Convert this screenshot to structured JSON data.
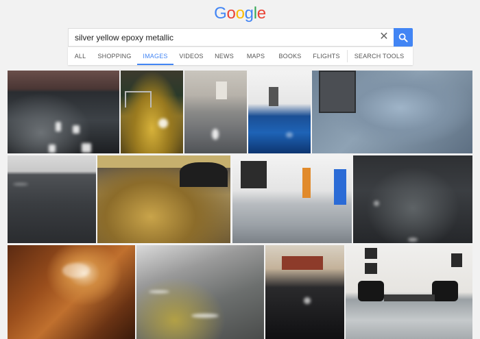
{
  "logo": {
    "letters": [
      "G",
      "o",
      "o",
      "g",
      "l",
      "e"
    ],
    "colors": [
      "#4285f4",
      "#ea4335",
      "#fbbc05",
      "#4285f4",
      "#34a853",
      "#ea4335"
    ]
  },
  "search": {
    "query": "silver yellow epoxy metallic",
    "clear_icon": "close-icon",
    "submit_icon": "search-icon"
  },
  "tabs": [
    "ALL",
    "SHOPPING",
    "IMAGES",
    "VIDEOS",
    "NEWS",
    "MAPS",
    "BOOKS",
    "FLIGHTS",
    "SEARCH TOOLS"
  ],
  "active_tab": "IMAGES",
  "accent_color": "#4285f4",
  "results": [
    {
      "name": "gray-metallic-floor-room"
    },
    {
      "name": "gold-metallic-floor-gym"
    },
    {
      "name": "gray-epoxy-floor-hallway"
    },
    {
      "name": "blue-metallic-floor-room"
    },
    {
      "name": "gray-metallic-floor-toolbox"
    },
    {
      "name": "dark-gray-metallic-floor"
    },
    {
      "name": "gold-glitter-floor"
    },
    {
      "name": "silver-floor-orange-doors"
    },
    {
      "name": "charcoal-metallic-floor"
    },
    {
      "name": "copper-metallic-floor"
    },
    {
      "name": "gray-yellow-marble-floor"
    },
    {
      "name": "black-flake-floor-showroom"
    },
    {
      "name": "silver-floor-lounge-chairs"
    }
  ]
}
